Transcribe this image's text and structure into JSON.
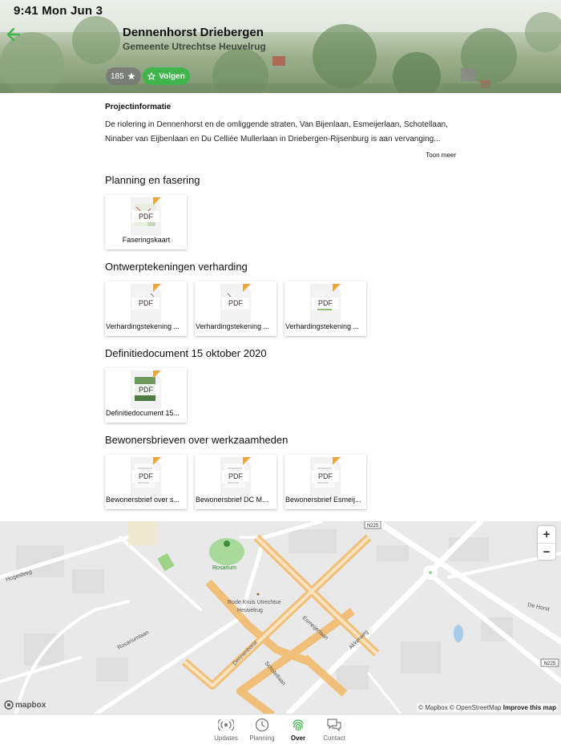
{
  "status_bar": {
    "time_date": "9:41  Mon Jun 3"
  },
  "header": {
    "title": "Dennenhorst Driebergen",
    "subtitle": "Gemeente Utrechtse Heuvelrug",
    "follower_count": "185",
    "follow_label": "Volgen",
    "accent_color": "#3fb54b"
  },
  "project_info": {
    "heading": "Projectinformatie",
    "text": "De riolering in Dennenhorst en de omliggende straten, Van Bijenlaan, Esmeijerlaan, Schotellaan, Ninaber van Eijbenlaan en Du Celliée Mullerlaan in Driebergen-Rijsenburg is aan vervanging...",
    "more_label": "Toon meer"
  },
  "sections": [
    {
      "title": "Planning en fasering",
      "documents": [
        {
          "label": "Faseringskaart",
          "badge": "PDF"
        }
      ]
    },
    {
      "title": "Ontwerptekeningen verharding",
      "documents": [
        {
          "label": "Verhardingstekening ...",
          "badge": "PDF"
        },
        {
          "label": "Verhardingstekening ...",
          "badge": "PDF"
        },
        {
          "label": "Verhardingstekening ...",
          "badge": "PDF"
        }
      ]
    },
    {
      "title": "Definitiedocument 15 oktober 2020",
      "documents": [
        {
          "label": "Definitiedocument 15...",
          "badge": "PDF"
        }
      ]
    },
    {
      "title": "Bewonersbrieven over werkzaamheden",
      "documents": [
        {
          "label": "Bewonersbrief over s...",
          "badge": "PDF"
        },
        {
          "label": "Bewonersbrief DC M...",
          "badge": "PDF"
        },
        {
          "label": "Bewonersbrief Esmeij...",
          "badge": "PDF"
        }
      ]
    }
  ],
  "map": {
    "labels": {
      "road_n225_top": "N225",
      "road_n225_right": "N225",
      "hogesteeg": "Hogesteeg",
      "rosarium": "Rosarium",
      "rode_kruis": "Rode Kruis Utrechtse",
      "heuvelrug": "Heuvelrug",
      "rosariumlaan": "Rosariumlaan",
      "dennenhorst": "Dennenhorst",
      "esmeijerlaan": "Esmeijerlaan",
      "schotellaan": "Schotellaan",
      "akkerweg": "Akkerweg",
      "de_horst": "De Horst"
    },
    "zoom_in": "+",
    "zoom_out": "−",
    "logo": "mapbox",
    "attribution": "© Mapbox © OpenStreetMap",
    "improve": "Improve this map",
    "highlight_color": "#f5c47a"
  },
  "tabs": [
    {
      "label": "Updates",
      "icon": "broadcast-icon",
      "active": false
    },
    {
      "label": "Planning",
      "icon": "clock-icon",
      "active": false
    },
    {
      "label": "Over",
      "icon": "fingerprint-icon",
      "active": true
    },
    {
      "label": "Contact",
      "icon": "chat-icon",
      "active": false
    }
  ]
}
